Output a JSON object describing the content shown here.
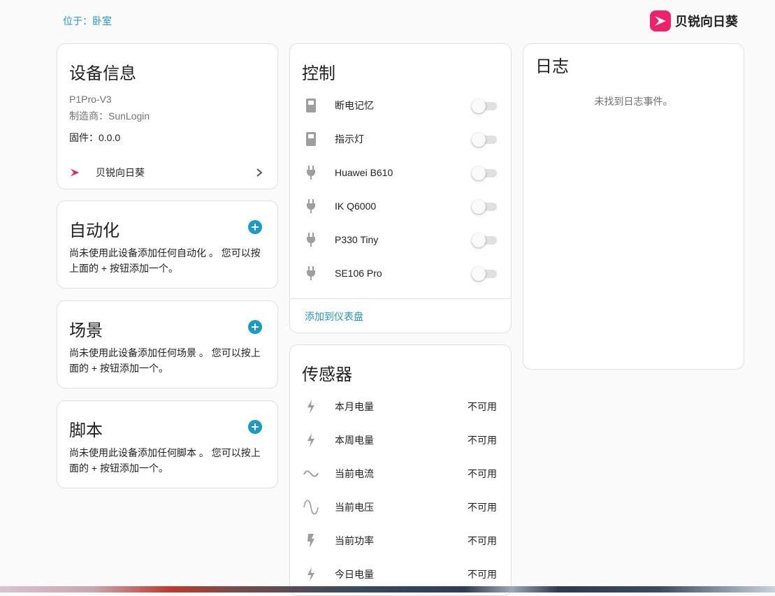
{
  "breadcrumb": {
    "prefix": "位于：",
    "room": "卧室"
  },
  "brand": {
    "name": "贝锐向日葵",
    "color": "#f0206b"
  },
  "device_info": {
    "title": "设备信息",
    "model": "P1Pro-V3",
    "manufacturer": "制造商：SunLogin",
    "firmware": "固件：0.0.0",
    "integration": "贝锐向日葵"
  },
  "automation": {
    "title": "自动化",
    "empty": "尚未使用此设备添加任何自动化 。 您可以按上面的 + 按钮添加一个。"
  },
  "scene": {
    "title": "场景",
    "empty": "尚未使用此设备添加任何场景 。 您可以按上面的 + 按钮添加一个。"
  },
  "script": {
    "title": "脚本",
    "empty": "尚未使用此设备添加任何脚本 。 您可以按上面的 + 按钮添加一个。"
  },
  "controls": {
    "title": "控制",
    "items": [
      {
        "label": "断电记忆",
        "icon": "switch-icon",
        "on": false
      },
      {
        "label": "指示灯",
        "icon": "switch-icon",
        "on": false
      },
      {
        "label": "Huawei B610",
        "icon": "power-plug-icon",
        "on": false
      },
      {
        "label": "IK Q6000",
        "icon": "power-plug-icon",
        "on": false
      },
      {
        "label": "P330 Tiny",
        "icon": "power-plug-icon",
        "on": false
      },
      {
        "label": "SE106 Pro",
        "icon": "power-plug-icon",
        "on": false
      }
    ],
    "add_to_dashboard": "添加到仪表盘"
  },
  "sensors": {
    "title": "传感器",
    "items": [
      {
        "label": "本月电量",
        "value": "不可用",
        "icon": "lightning-icon"
      },
      {
        "label": "本周电量",
        "value": "不可用",
        "icon": "lightning-icon"
      },
      {
        "label": "当前电流",
        "value": "不可用",
        "icon": "current-ac-icon"
      },
      {
        "label": "当前电压",
        "value": "不可用",
        "icon": "sine-wave-icon"
      },
      {
        "label": "当前功率",
        "value": "不可用",
        "icon": "flash-icon"
      },
      {
        "label": "今日电量",
        "value": "不可用",
        "icon": "lightning-icon"
      }
    ]
  },
  "logbook": {
    "title": "日志",
    "empty": "未找到日志事件。"
  },
  "colors": {
    "accent": "#1f97c9",
    "icon": "#9e9e9e"
  }
}
